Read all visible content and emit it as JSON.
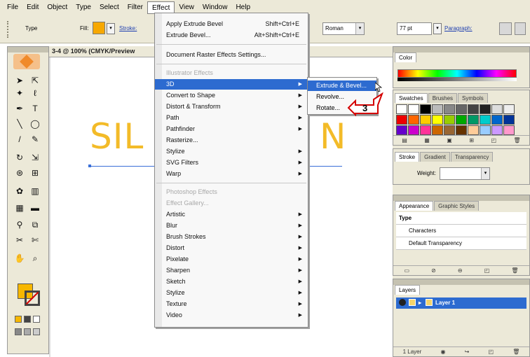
{
  "menubar": {
    "items": [
      "File",
      "Edit",
      "Object",
      "Type",
      "Select",
      "Filter",
      "Effect",
      "View",
      "Window",
      "Help"
    ],
    "active_index": 6
  },
  "control_bar": {
    "type_label": "Type",
    "fill_label": "Fill:",
    "stroke_label": "Stroke:",
    "font_style": "Roman",
    "font_size": "77 pt",
    "paragraph_label": "Paragraph:"
  },
  "document": {
    "title": "3-4 @ 100% (CMYK/Preview",
    "artwork_text_start": "SIL",
    "artwork_text_end": "N",
    "artwork_color": "#f3bb28"
  },
  "effect_menu": {
    "apply_last": {
      "label": "Apply Extrude Bevel",
      "shortcut": "Shift+Ctrl+E"
    },
    "last_effect": {
      "label": "Extrude Bevel...",
      "shortcut": "Alt+Shift+Ctrl+E"
    },
    "raster_settings": "Document Raster Effects Settings...",
    "illustrator_header": "Illustrator Effects",
    "illustrator_items": [
      "3D",
      "Convert to Shape",
      "Distort & Transform",
      "Path",
      "Pathfinder",
      "Rasterize...",
      "Stylize",
      "SVG Filters",
      "Warp"
    ],
    "photoshop_header": "Photoshop Effects",
    "photoshop_items": [
      "Effect Gallery...",
      "Artistic",
      "Blur",
      "Brush Strokes",
      "Distort",
      "Pixelate",
      "Sharpen",
      "Sketch",
      "Stylize",
      "Texture",
      "Video"
    ]
  },
  "submenu_3d": {
    "items": [
      "Extrude & Bevel...",
      "Revolve...",
      "Rotate..."
    ]
  },
  "callout": {
    "step": "3"
  },
  "panels": {
    "color": {
      "title": "Color"
    },
    "swatches": {
      "tabs": [
        "Swatches",
        "Brushes",
        "Symbols"
      ]
    },
    "stroke": {
      "tabs": [
        "Stroke",
        "Gradient",
        "Transparency"
      ],
      "weight_label": "Weight:"
    },
    "appearance": {
      "tabs": [
        "Appearance",
        "Graphic Styles"
      ],
      "rows": [
        "Type",
        "Characters",
        "Default Transparency"
      ]
    },
    "layers": {
      "tab": "Layers",
      "layer_name": "Layer 1",
      "footer": "1 Layer"
    }
  }
}
